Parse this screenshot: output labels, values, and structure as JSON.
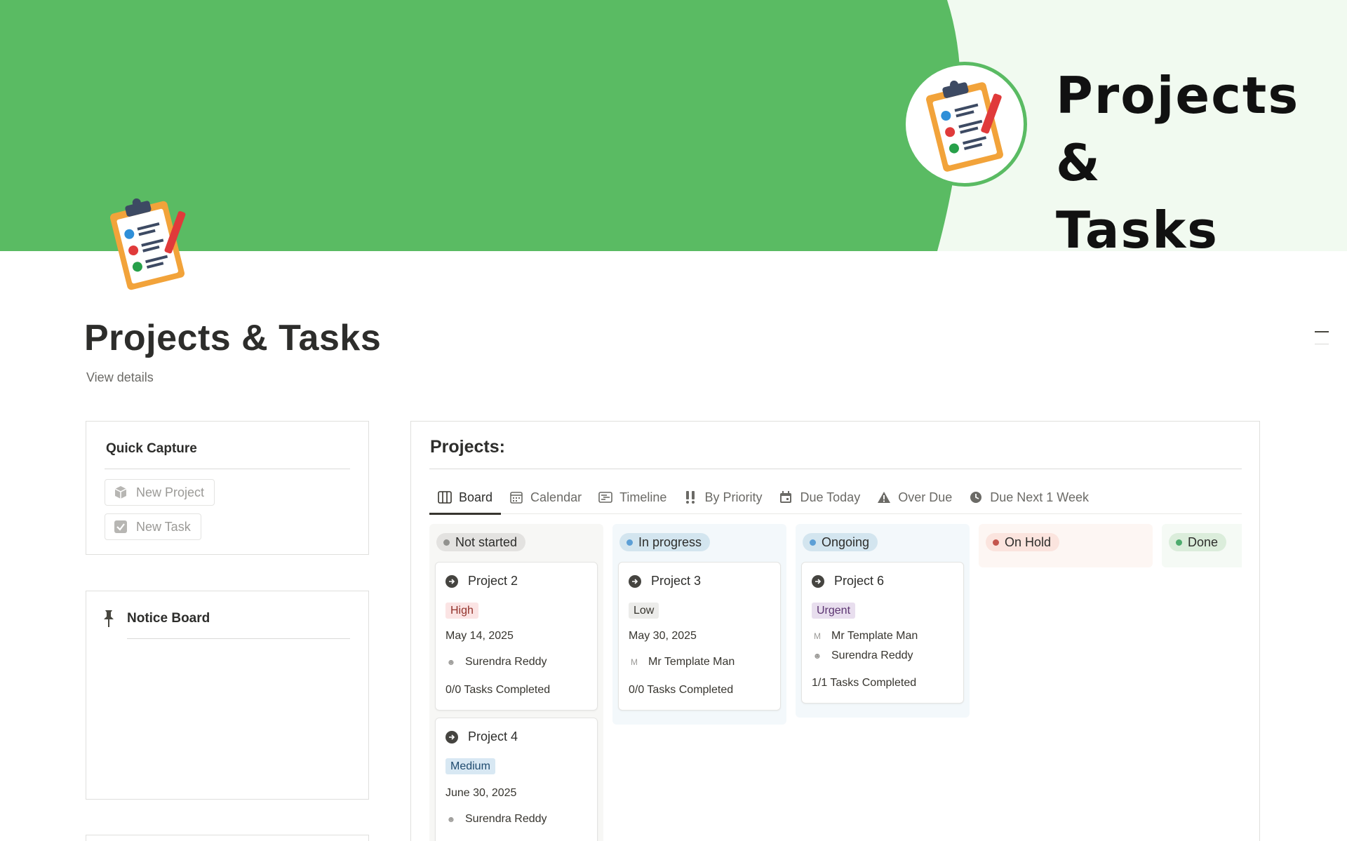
{
  "cover": {
    "title_line1": "Projects &",
    "title_line2": "Tasks",
    "green": "#5abb63",
    "background": "#f1faf0"
  },
  "page": {
    "title": "Projects & Tasks",
    "view_details": "View details"
  },
  "quick_capture": {
    "title": "Quick Capture",
    "buttons": [
      {
        "label": "New Project",
        "icon": "cube-icon"
      },
      {
        "label": "New Task",
        "icon": "checkbox-icon"
      }
    ]
  },
  "notice_board": {
    "title": "Notice Board",
    "icon": "pin-icon"
  },
  "projects": {
    "title": "Projects:",
    "tabs": [
      {
        "label": "Board",
        "icon": "board-icon",
        "active": true
      },
      {
        "label": "Calendar",
        "icon": "calendar-icon"
      },
      {
        "label": "Timeline",
        "icon": "timeline-icon"
      },
      {
        "label": "By Priority",
        "icon": "double-exclamation-icon"
      },
      {
        "label": "Due Today",
        "icon": "calendar-today-icon"
      },
      {
        "label": "Over Due",
        "icon": "warning-icon"
      },
      {
        "label": "Due Next 1 Week",
        "icon": "clock-icon"
      }
    ],
    "columns": [
      {
        "status": "Not started",
        "dot": "#91918e",
        "pill_bg": "#e3e2e0",
        "col_bg": "#f7f7f5",
        "cards": [
          {
            "name": "Project 2",
            "priority": "High",
            "priority_bg": "#fbe4e4",
            "priority_fg": "#93322b",
            "date": "May 14, 2025",
            "people": [
              "Surendra Reddy"
            ],
            "progress": "0/0 Tasks Completed"
          },
          {
            "name": "Project 4",
            "priority": "Medium",
            "priority_bg": "#d8e8f3",
            "priority_fg": "#1f4b6e",
            "date": "June 30, 2025",
            "people": [
              "Surendra Reddy"
            ],
            "progress": ""
          }
        ]
      },
      {
        "status": "In progress",
        "dot": "#5c9fd6",
        "pill_bg": "#d3e5ef",
        "col_bg": "#f3f8fb",
        "cards": [
          {
            "name": "Project 3",
            "priority": "Low",
            "priority_bg": "#ececea",
            "priority_fg": "#37352f",
            "date": "May 30, 2025",
            "people": [
              "Mr Template Man"
            ],
            "progress": "0/0 Tasks Completed"
          }
        ]
      },
      {
        "status": "Ongoing",
        "dot": "#5c9fd6",
        "pill_bg": "#d3e5ef",
        "col_bg": "#f3f8fb",
        "cards": [
          {
            "name": "Project 6",
            "priority": "Urgent",
            "priority_bg": "#e8deee",
            "priority_fg": "#5b3471",
            "date": "",
            "people": [
              "Mr Template Man",
              "Surendra Reddy"
            ],
            "progress": "1/1 Tasks Completed"
          }
        ]
      },
      {
        "status": "On Hold",
        "dot": "#c4554d",
        "pill_bg": "#fbe4de",
        "col_bg": "#fdf6f3",
        "cards": []
      },
      {
        "status": "Done",
        "dot": "#4dab6d",
        "pill_bg": "#dbeddb",
        "col_bg": "#f5faf5",
        "cards": []
      }
    ]
  }
}
